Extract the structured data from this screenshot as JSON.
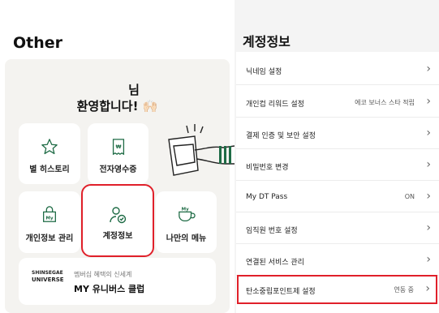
{
  "left": {
    "title": "Other",
    "welcome_line1": "님",
    "welcome_line2": "환영합니다!",
    "welcome_emoji": "🙌🏻",
    "tiles": [
      {
        "label": "별 히스토리",
        "icon": "star-icon"
      },
      {
        "label": "전자영수증",
        "icon": "receipt-icon"
      },
      {
        "label": "개인정보 관리",
        "icon": "my-bag-icon"
      },
      {
        "label": "계정정보",
        "icon": "person-check-icon"
      },
      {
        "label": "나만의 메뉴",
        "icon": "my-cup-icon"
      }
    ],
    "banner": {
      "logo_line1": "SHINSEGAE",
      "logo_line2": "UNIVERSE",
      "subtitle": "멤버십 혜택의 신세계",
      "title": "MY 유니버스 클럽"
    }
  },
  "right": {
    "title": "계정정보",
    "rows": [
      {
        "label": "닉네임 설정",
        "value": ""
      },
      {
        "label": "개인컵 리워드 설정",
        "value": "에코 보너스 스타 적립"
      },
      {
        "label": "결제 인증 및 보안 설정",
        "value": ""
      },
      {
        "label": "비밀번호 변경",
        "value": ""
      },
      {
        "label": "My DT Pass",
        "value": "ON"
      },
      {
        "label": "임직원 번호 설정",
        "value": ""
      },
      {
        "label": "연결된 서비스 관리",
        "value": ""
      },
      {
        "label": "탄소중립포인트제 설정",
        "value": "연동 중"
      }
    ],
    "chevron": "›"
  },
  "colors": {
    "highlight": "#e0202a",
    "accent_green": "#1e6b45"
  }
}
